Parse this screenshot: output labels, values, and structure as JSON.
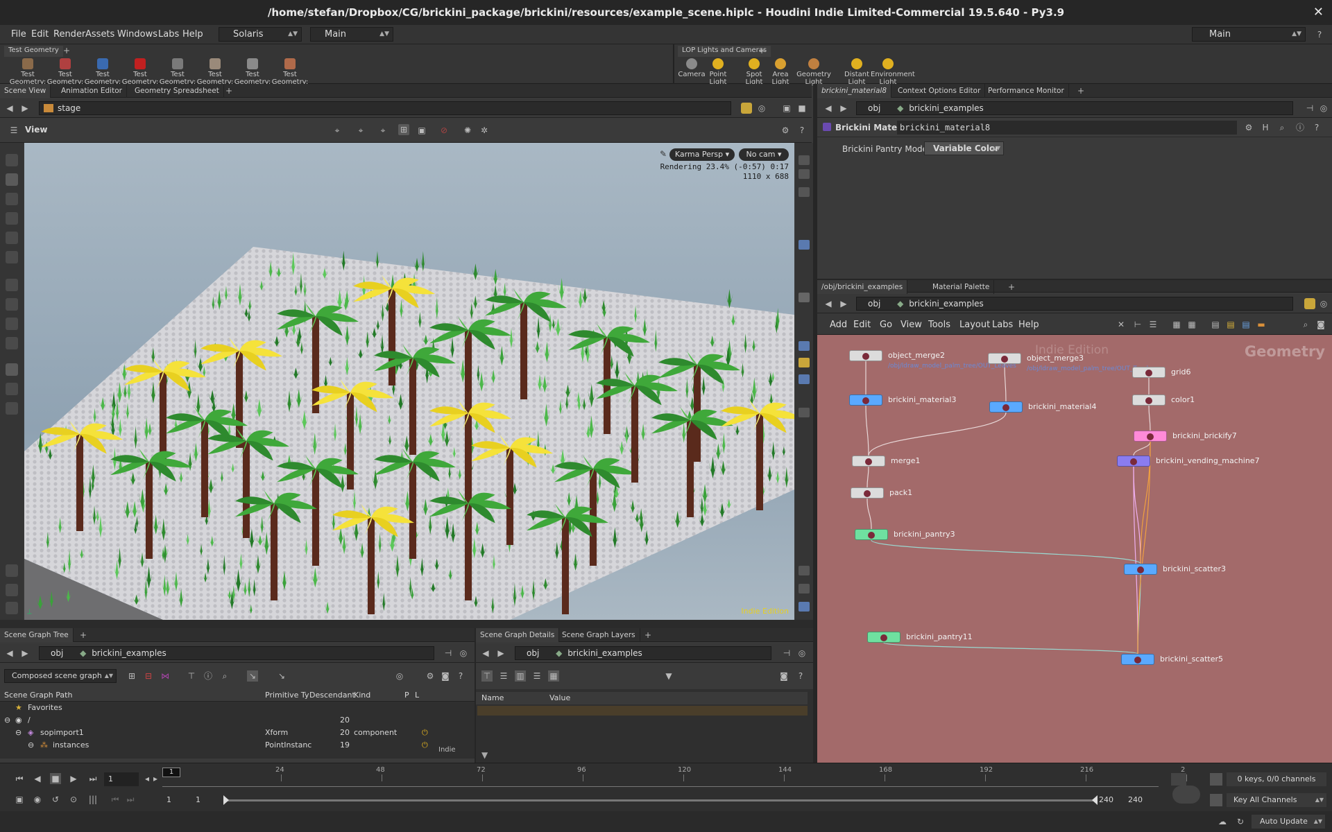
{
  "window": {
    "title": "/home/stefan/Dropbox/CG/brickini_package/brickini/resources/example_scene.hiplc - Houdini Indie Limited-Commercial 19.5.640 - Py3.9",
    "close": "✕"
  },
  "menubar": {
    "items": [
      "File",
      "Edit",
      "Render",
      "Assets",
      "Windows",
      "Labs",
      "Help"
    ],
    "desktop": "Solaris",
    "context": "Main",
    "right_desktop": "Main"
  },
  "shelf_left": {
    "tab": "Test Geometry",
    "tools": [
      "Test Geometry: C...",
      "Test Geometry: P...",
      "Test Geometry: R...",
      "Test Geometry: S...",
      "Test Geometry: S...",
      "Test Geometry: T...",
      "Test Geometry: T...",
      "Test Geometry: T..."
    ]
  },
  "shelf_right": {
    "tab": "LOP Lights and Cameras",
    "tools": [
      "Camera",
      "Point Light",
      "Spot Light",
      "Area Light",
      "Geometry Light",
      "Distant Light",
      "Environment Light"
    ]
  },
  "viewer": {
    "tabs": [
      "Scene View",
      "Animation Editor",
      "Geometry Spreadsheet"
    ],
    "path": "stage",
    "label": "View",
    "renderer": "Karma Persp",
    "camera": "No cam",
    "status_line1": "Rendering  23.4%  (-0:57)  0:17",
    "status_line2": "1110 x 688",
    "watermark": "Indie Edition"
  },
  "param_pane": {
    "tabs": [
      "brickini_material8",
      "Context Options Editor",
      "Performance Monitor"
    ],
    "path_root": "obj",
    "path_node": "brickini_examples",
    "node_type": "Brickini Material",
    "node_name": "brickini_material8",
    "param_label": "Brickini Pantry Mode",
    "param_value": "Variable Color"
  },
  "network": {
    "tabs": [
      "/obj/brickini_examples",
      "Material Palette"
    ],
    "path_root": "obj",
    "path_node": "brickini_examples",
    "menu": [
      "Add",
      "Edit",
      "Go",
      "View",
      "Tools",
      "Layout",
      "Labs",
      "Help"
    ],
    "watermark": "Indie Edition",
    "context_label": "Geometry",
    "nodes": [
      {
        "name": "object_merge2",
        "color": "#dcdcdc",
        "sub": "/obj/ldraw_model_palm_tree/OUT_Leaves"
      },
      {
        "name": "object_merge3",
        "color": "#dcdcdc",
        "sub": "/obj/ldraw_model_palm_tree/OUT_Trunk"
      },
      {
        "name": "grid6",
        "color": "#dcdcdc",
        "sub": ""
      },
      {
        "name": "color1",
        "color": "#dcdcdc",
        "sub": ""
      },
      {
        "name": "brickini_material3",
        "color": "#5aa9ff",
        "sub": ""
      },
      {
        "name": "brickini_material4",
        "color": "#5aa9ff",
        "sub": ""
      },
      {
        "name": "brickini_brickify7",
        "color": "#ff8ad8",
        "sub": ""
      },
      {
        "name": "brickini_vending_machine7",
        "color": "#8a7cf0",
        "sub": ""
      },
      {
        "name": "merge1",
        "color": "#dcdcdc",
        "sub": ""
      },
      {
        "name": "pack1",
        "color": "#dcdcdc",
        "sub": ""
      },
      {
        "name": "brickini_pantry3",
        "color": "#6fe0a0",
        "sub": ""
      },
      {
        "name": "brickini_scatter3",
        "color": "#5aa9ff",
        "sub": ""
      },
      {
        "name": "brickini_pantry11",
        "color": "#6fe0a0",
        "sub": ""
      },
      {
        "name": "brickini_scatter5",
        "color": "#5aa9ff",
        "sub": ""
      }
    ]
  },
  "scene_graph": {
    "tabs": [
      "Scene Graph Tree"
    ],
    "path_root": "obj",
    "path_node": "brickini_examples",
    "mode": "Composed scene graph",
    "columns": [
      "Scene Graph Path",
      "Primitive Ty",
      "Descendant",
      "Kind",
      "P",
      "L"
    ],
    "rows": [
      {
        "path": "Favorites",
        "type": "",
        "desc": "",
        "kind": ""
      },
      {
        "path": "/",
        "type": "",
        "desc": "20",
        "kind": ""
      },
      {
        "path": "sopimport1",
        "type": "Xform",
        "desc": "20",
        "kind": "component"
      },
      {
        "path": "instances",
        "type": "PointInstanc",
        "desc": "19",
        "kind": ""
      }
    ],
    "watermark": "Indie"
  },
  "details": {
    "tabs": [
      "Scene Graph Details",
      "Scene Graph Layers"
    ],
    "path_root": "obj",
    "path_node": "brickini_examples",
    "columns": [
      "Name",
      "Value"
    ]
  },
  "timeline": {
    "ticks": [
      "24",
      "48",
      "72",
      "96",
      "120",
      "144",
      "168",
      "192",
      "216",
      "2"
    ],
    "current_frame": "1",
    "frame_field": "1",
    "range_start": "1",
    "range_start2": "1",
    "range_end": "240",
    "range_end2": "240",
    "keys": "0 keys, 0/0 channels",
    "key_mode": "Key All Channels",
    "update": "Auto Update"
  },
  "colors": {
    "network_bg": "#a36a6a",
    "palm_yellow": "#f5e23a",
    "palm_green": "#3fa83a",
    "trunk": "#5a2a1c",
    "plate": "#d8d8dc"
  }
}
